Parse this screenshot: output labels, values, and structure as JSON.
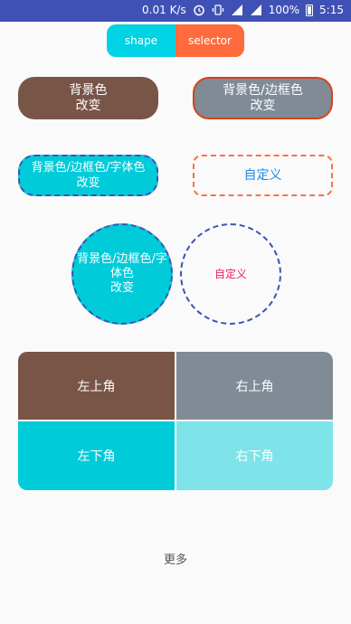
{
  "status_bar": {
    "speed": "0.01 K/s",
    "battery": "100%",
    "time": "5:15"
  },
  "segmented": {
    "left": "shape",
    "right": "selector"
  },
  "buttons": {
    "bg_change": "背景色\n改变",
    "bg_border_change": "背景色/边框色\n改变",
    "bg_border_text_change": "背景色/边框色/字体色\n改变",
    "custom": "自定义"
  },
  "circles": {
    "bg_border_text_change": "背景色/边框色/字\n体色\n改变",
    "custom": "自定义"
  },
  "corners": {
    "top_left": "左上角",
    "top_right": "右上角",
    "bottom_left": "左下角",
    "bottom_right": "右下角"
  },
  "more": "更多"
}
